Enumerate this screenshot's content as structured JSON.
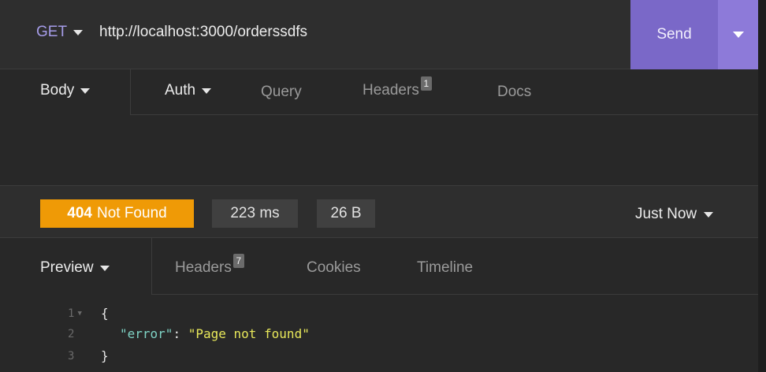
{
  "request": {
    "method": "GET",
    "url": "http://localhost:3000/orderssdfs",
    "send_label": "Send",
    "tabs": [
      {
        "label": "Body"
      },
      {
        "label": "Auth"
      },
      {
        "label": "Query"
      },
      {
        "label": "Headers",
        "badge": "1"
      },
      {
        "label": "Docs"
      }
    ]
  },
  "response": {
    "status_code": "404",
    "status_text": "Not Found",
    "time": "223 ms",
    "size": "26 B",
    "when": "Just Now",
    "tabs": [
      {
        "label": "Preview"
      },
      {
        "label": "Headers",
        "badge": "7"
      },
      {
        "label": "Cookies"
      },
      {
        "label": "Timeline"
      }
    ],
    "body": {
      "line_numbers": [
        "1",
        "2",
        "3"
      ],
      "open_brace": "{",
      "key": "\"error\"",
      "colon": ": ",
      "value": "\"Page not found\"",
      "close_brace": "}"
    }
  },
  "colors": {
    "accent": "#7a68c8",
    "status_error": "#ef9a06",
    "background": "#282828"
  }
}
